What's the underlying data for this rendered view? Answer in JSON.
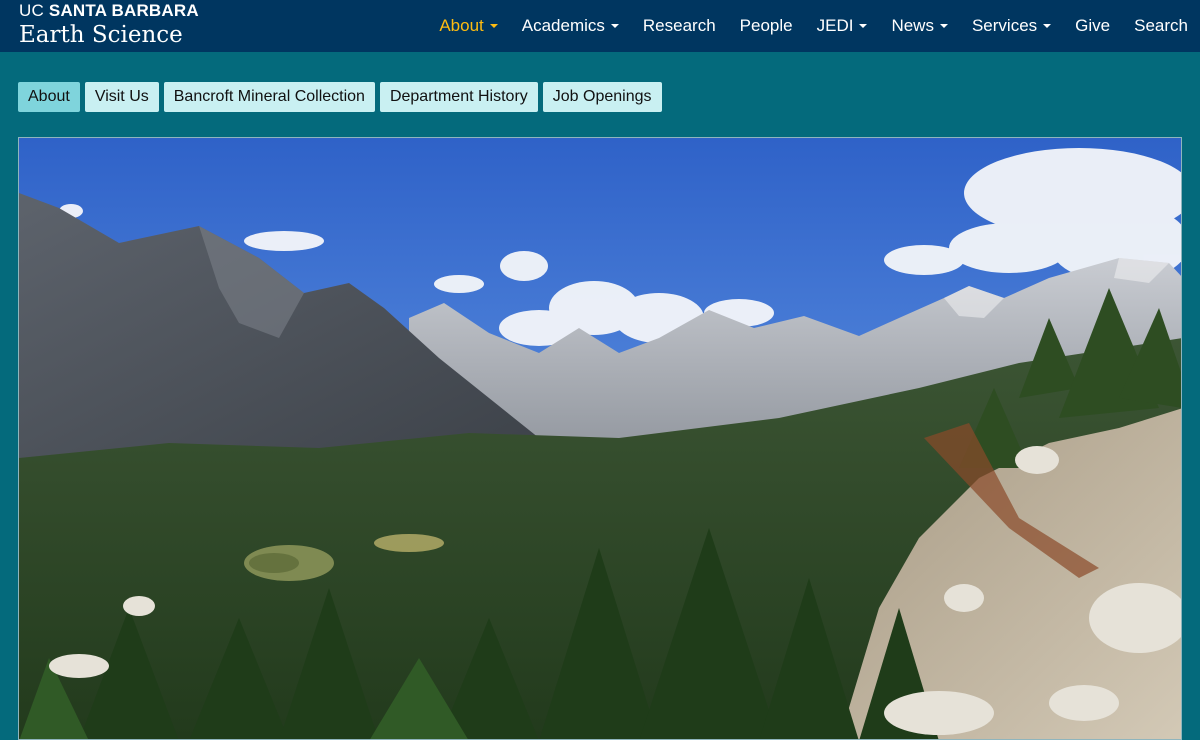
{
  "brand": {
    "line1_uc": "UC",
    "line1_sb": "SANTA BARBARA",
    "line2": "Earth Science"
  },
  "nav": {
    "items": [
      {
        "label": "About",
        "dropdown": true,
        "active": true
      },
      {
        "label": "Academics",
        "dropdown": true,
        "active": false
      },
      {
        "label": "Research",
        "dropdown": false,
        "active": false
      },
      {
        "label": "People",
        "dropdown": false,
        "active": false
      },
      {
        "label": "JEDI",
        "dropdown": true,
        "active": false
      },
      {
        "label": "News",
        "dropdown": true,
        "active": false
      },
      {
        "label": "Services",
        "dropdown": true,
        "active": false
      },
      {
        "label": "Give",
        "dropdown": false,
        "active": false
      },
      {
        "label": "Search",
        "dropdown": false,
        "active": false
      }
    ]
  },
  "subnav": {
    "tabs": [
      {
        "label": "About",
        "active": true
      },
      {
        "label": "Visit Us",
        "active": false
      },
      {
        "label": "Bancroft Mineral Collection",
        "active": false
      },
      {
        "label": "Department History",
        "active": false
      },
      {
        "label": "Job Openings",
        "active": false
      }
    ]
  },
  "colors": {
    "header_bg": "#003660",
    "page_bg": "#046a7c",
    "nav_active": "#febc11",
    "tab_bg": "#c9f0f2",
    "tab_active_bg": "#7fd4dc"
  }
}
